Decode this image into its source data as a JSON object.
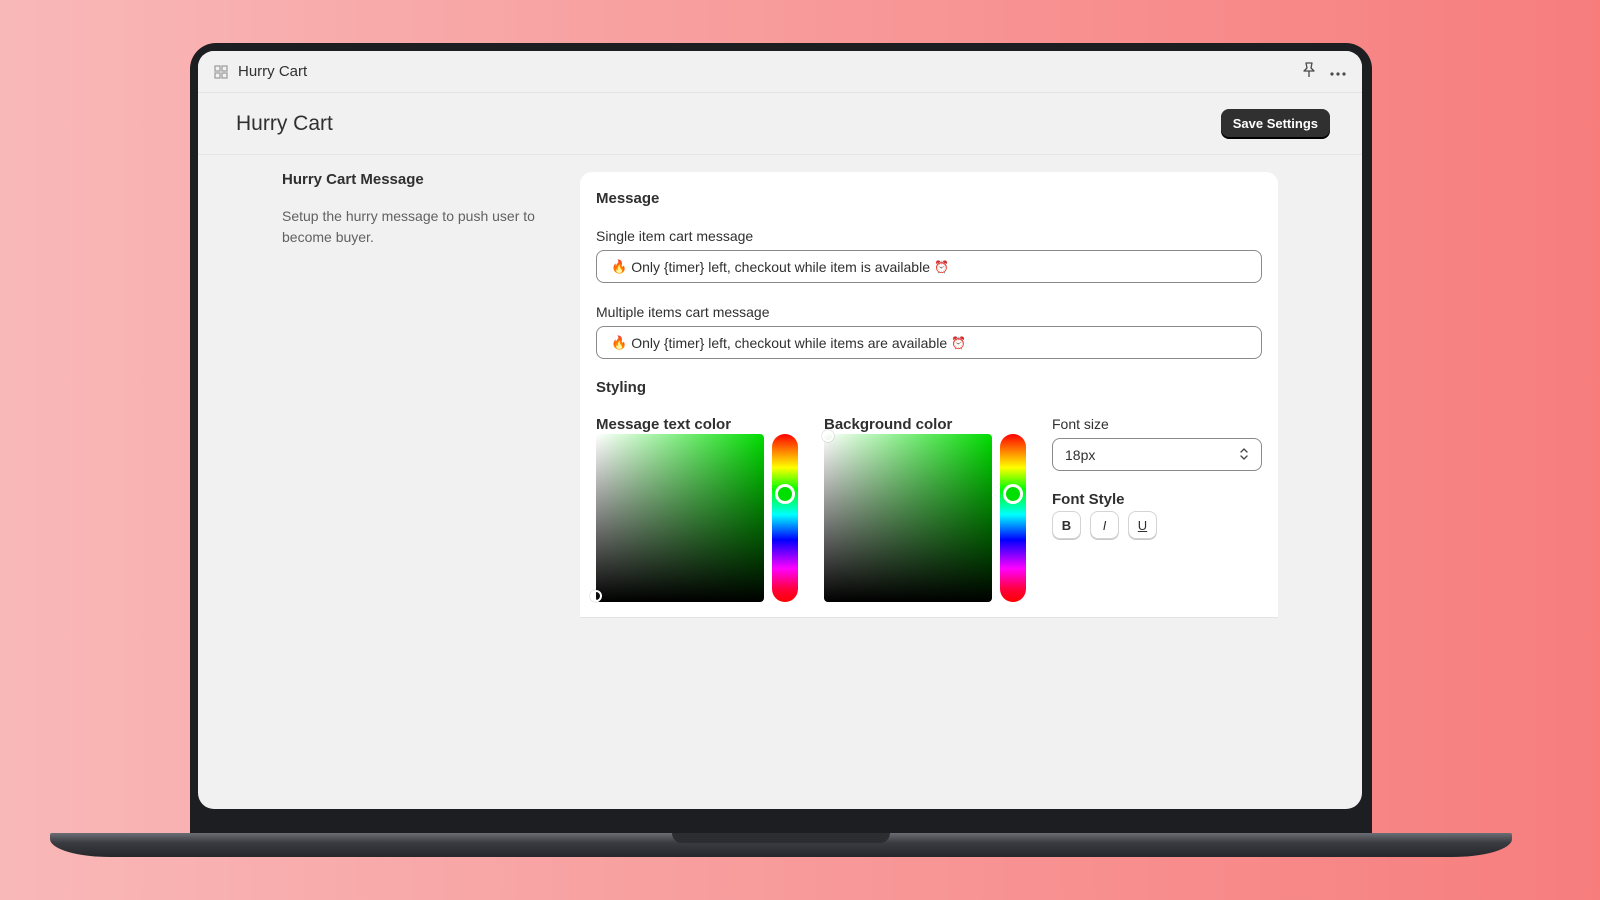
{
  "app": {
    "window_title": "Hurry Cart",
    "page_title": "Hurry Cart",
    "save_label": "Save Settings"
  },
  "section": {
    "title": "Hurry Cart Message",
    "description": "Setup the hurry message to push user to become buyer."
  },
  "message": {
    "heading": "Message",
    "single_label": "Single item cart message",
    "single_value": "Only {timer} left, checkout while item is available",
    "multiple_label": "Multiple items cart message",
    "multiple_value": "Only {timer} left, checkout while items are available",
    "prefix_icon": "fire-icon",
    "suffix_icon": "alarm-clock-icon"
  },
  "styling": {
    "heading": "Styling",
    "text_color_label": "Message text color",
    "background_color_label": "Background color",
    "picker_hue": "#00dc00",
    "font_size_label": "Font size",
    "font_size_value": "18px",
    "font_style_label": "Font Style",
    "bold_label": "B",
    "italic_label": "I",
    "underline_label": "U"
  },
  "colors": {
    "primary_button": "#303030",
    "text": "#303030",
    "background_gradient_start": "#f9b8b8",
    "background_gradient_end": "#f77d7d"
  }
}
